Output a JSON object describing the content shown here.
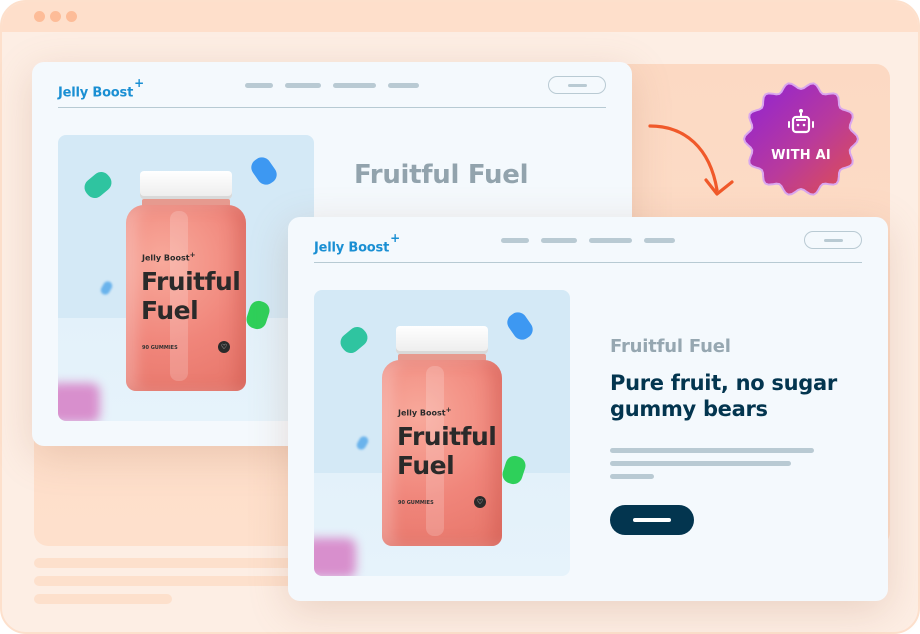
{
  "window": {
    "controls": [
      "close-dot",
      "minimize-dot",
      "maximize-dot"
    ]
  },
  "old_page": {
    "logo": "Jelly Boost",
    "logo_mark": "+",
    "title": "Fruitful Fuel",
    "product": {
      "brand": "Jelly Boost",
      "brand_mark": "+",
      "name_line1": "Fruitful",
      "name_line2": "Fuel",
      "count": "90 GUMMIES",
      "badge_icon": "♡"
    }
  },
  "new_page": {
    "logo": "Jelly Boost",
    "logo_mark": "+",
    "eyebrow": "Fruitful Fuel",
    "heading": "Pure fruit, no sugar gummy bears",
    "product": {
      "brand": "Jelly Boost",
      "brand_mark": "+",
      "name_line1": "Fruitful",
      "name_line2": "Fuel",
      "count": "90 GUMMIES",
      "badge_icon": "♡"
    }
  },
  "ai_badge": {
    "label": "WITH AI",
    "icon": "robot-icon"
  },
  "colors": {
    "brand_blue": "#1a8fd3",
    "heading_navy": "#03354f",
    "muted_gray": "#96a7b1",
    "placeholder": "#b9cad3",
    "arrow": "#f0592a",
    "badge_start": "#8e22d6",
    "badge_end": "#e2504a",
    "background_peach": "#fdeee4"
  }
}
